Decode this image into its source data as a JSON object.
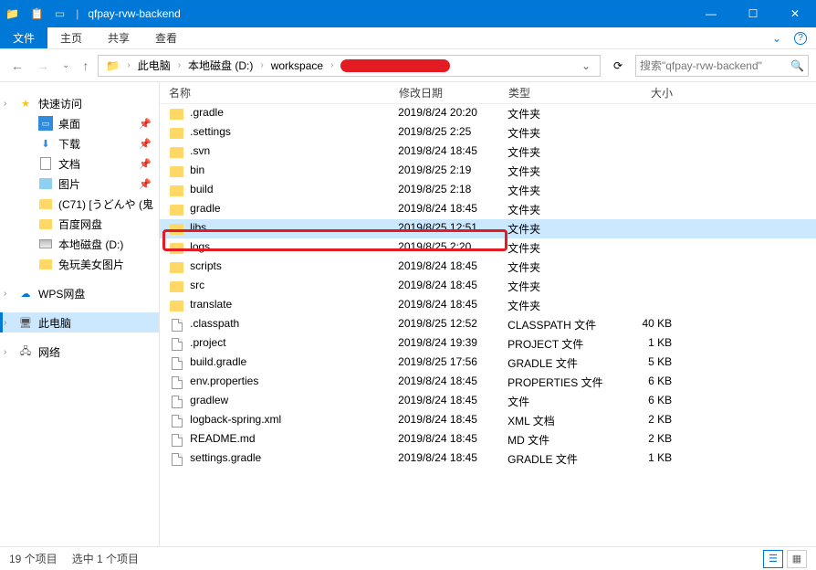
{
  "title": "qfpay-rvw-backend",
  "menu": {
    "file": "文件",
    "home": "主页",
    "share": "共享",
    "view": "查看"
  },
  "breadcrumb": {
    "this_pc": "此电脑",
    "drive": "本地磁盘 (D:)",
    "workspace": "workspace"
  },
  "search_placeholder": "搜索\"qfpay-rvw-backend\"",
  "nav": {
    "quick_access": "快速访问",
    "desktop": "桌面",
    "downloads": "下载",
    "documents": "文档",
    "pictures": "图片",
    "c71": "(C71) [うどんや (鬼",
    "baidu": "百度网盘",
    "local_d": "本地磁盘 (D:)",
    "rabbit": "兔玩美女图片",
    "wps": "WPS网盘",
    "this_pc": "此电脑",
    "network": "网络"
  },
  "columns": {
    "name": "名称",
    "date": "修改日期",
    "type": "类型",
    "size": "大小"
  },
  "file_types": {
    "folder": "文件夹",
    "classpath": "CLASSPATH 文件",
    "project": "PROJECT 文件",
    "gradle": "GRADLE 文件",
    "properties": "PROPERTIES 文件",
    "xml": "XML 文档",
    "md": "MD 文件"
  },
  "files": [
    {
      "icon": "folder",
      "name": ".gradle",
      "date": "2019/8/24 20:20",
      "type": "文件夹",
      "size": ""
    },
    {
      "icon": "folder",
      "name": ".settings",
      "date": "2019/8/25 2:25",
      "type": "文件夹",
      "size": ""
    },
    {
      "icon": "folder",
      "name": ".svn",
      "date": "2019/8/24 18:45",
      "type": "文件夹",
      "size": ""
    },
    {
      "icon": "folder",
      "name": "bin",
      "date": "2019/8/25 2:19",
      "type": "文件夹",
      "size": ""
    },
    {
      "icon": "folder",
      "name": "build",
      "date": "2019/8/25 2:18",
      "type": "文件夹",
      "size": ""
    },
    {
      "icon": "folder",
      "name": "gradle",
      "date": "2019/8/24 18:45",
      "type": "文件夹",
      "size": ""
    },
    {
      "icon": "folder",
      "name": "libs",
      "date": "2019/8/25 12:51",
      "type": "文件夹",
      "size": "",
      "selected": true
    },
    {
      "icon": "folder",
      "name": "logs",
      "date": "2019/8/25 2:20",
      "type": "文件夹",
      "size": ""
    },
    {
      "icon": "folder",
      "name": "scripts",
      "date": "2019/8/24 18:45",
      "type": "文件夹",
      "size": ""
    },
    {
      "icon": "folder",
      "name": "src",
      "date": "2019/8/24 18:45",
      "type": "文件夹",
      "size": ""
    },
    {
      "icon": "folder",
      "name": "translate",
      "date": "2019/8/24 18:45",
      "type": "文件夹",
      "size": ""
    },
    {
      "icon": "file",
      "name": ".classpath",
      "date": "2019/8/25 12:52",
      "type": "CLASSPATH 文件",
      "size": "40 KB"
    },
    {
      "icon": "file",
      "name": ".project",
      "date": "2019/8/24 19:39",
      "type": "PROJECT 文件",
      "size": "1 KB"
    },
    {
      "icon": "file",
      "name": "build.gradle",
      "date": "2019/8/25 17:56",
      "type": "GRADLE 文件",
      "size": "5 KB"
    },
    {
      "icon": "file",
      "name": "env.properties",
      "date": "2019/8/24 18:45",
      "type": "PROPERTIES 文件",
      "size": "6 KB"
    },
    {
      "icon": "file",
      "name": "gradlew",
      "date": "2019/8/24 18:45",
      "type": "文件",
      "size": "6 KB"
    },
    {
      "icon": "file",
      "name": "logback-spring.xml",
      "date": "2019/8/24 18:45",
      "type": "XML 文档",
      "size": "2 KB"
    },
    {
      "icon": "file",
      "name": "README.md",
      "date": "2019/8/24 18:45",
      "type": "MD 文件",
      "size": "2 KB"
    },
    {
      "icon": "file",
      "name": "settings.gradle",
      "date": "2019/8/24 18:45",
      "type": "GRADLE 文件",
      "size": "1 KB"
    }
  ],
  "status": {
    "count": "19 个项目",
    "selected": "选中 1 个项目"
  }
}
